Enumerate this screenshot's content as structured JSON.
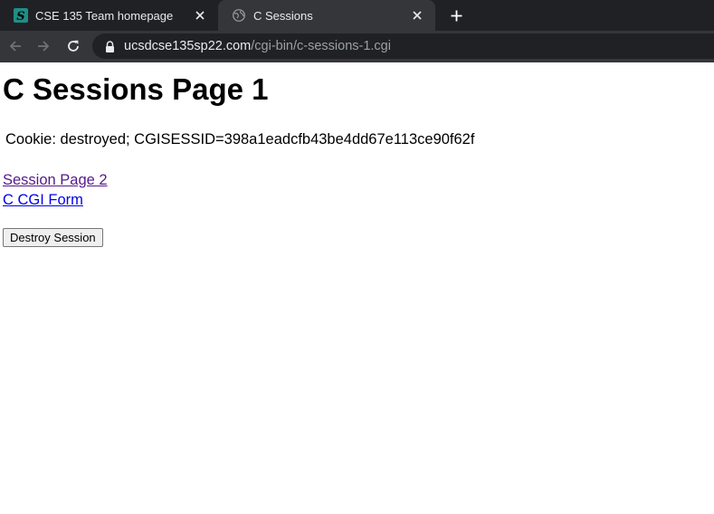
{
  "browser": {
    "tabs": [
      {
        "title": "CSE 135 Team homepage",
        "favicon": "s-logo-icon",
        "active": false
      },
      {
        "title": "C Sessions",
        "favicon": "globe-icon",
        "active": true
      }
    ],
    "url_host": "ucsdcse135sp22.com",
    "url_path": "/cgi-bin/c-sessions-1.cgi"
  },
  "page": {
    "heading": "C Sessions Page 1",
    "cookie_text": "Cookie: destroyed; CGISESSID=398a1eadcfb43be4dd67e113ce90f62f",
    "links": [
      {
        "label": "Session Page 2",
        "visited": true
      },
      {
        "label": "C CGI Form",
        "visited": false
      }
    ],
    "destroy_button": "Destroy Session"
  },
  "colors": {
    "tab_strip": "#202124",
    "active_tab": "#35363a",
    "visited_link": "#551a8b",
    "unvisited_link": "#0000ee"
  }
}
